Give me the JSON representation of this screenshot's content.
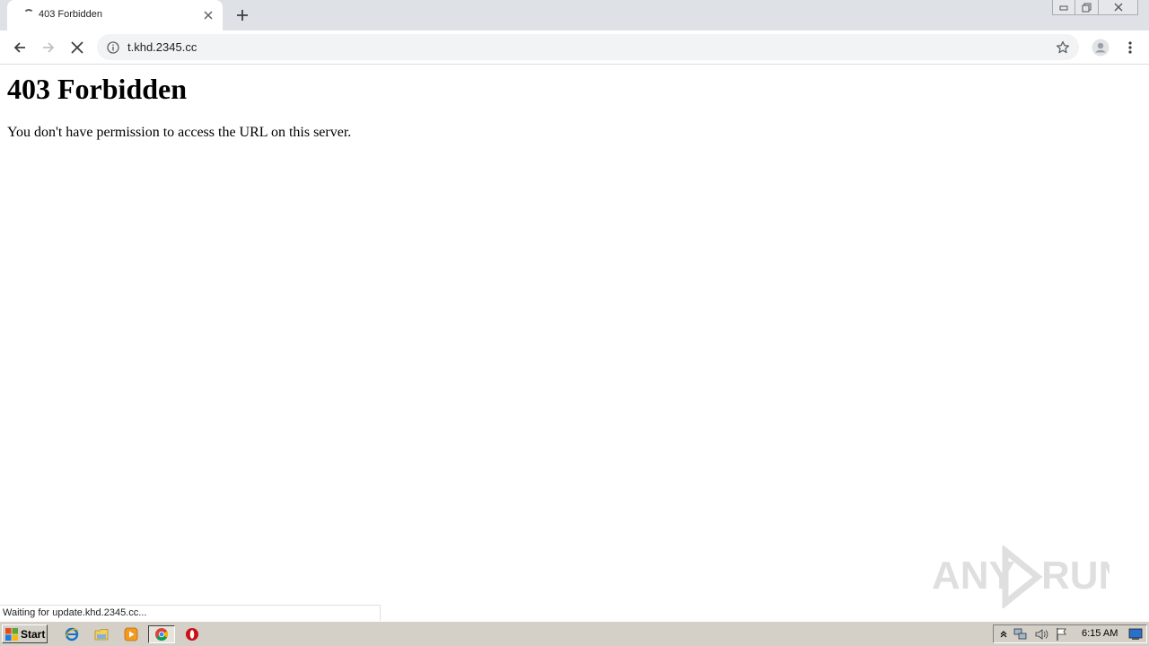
{
  "browser": {
    "tab": {
      "title": "403 Forbidden"
    },
    "omnibox": {
      "url": "t.khd.2345.cc"
    },
    "status": "Waiting for update.khd.2345.cc..."
  },
  "page": {
    "heading": "403 Forbidden",
    "message": "You don't have permission to access the URL on this server."
  },
  "watermark": {
    "text": "ANY RUN"
  },
  "taskbar": {
    "start_label": "Start",
    "clock": "6:15 AM"
  },
  "colors": {
    "tabstrip": "#dee1e6",
    "omnibox": "#f1f3f4",
    "taskbar": "#d4d0c8",
    "opera_red": "#cc0f16"
  }
}
